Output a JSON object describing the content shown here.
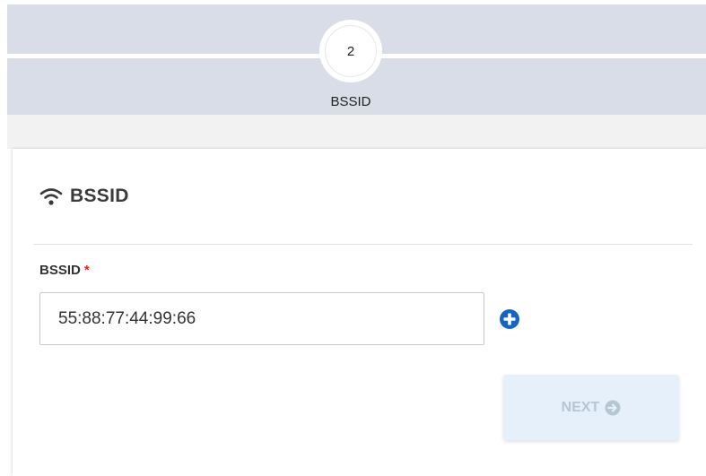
{
  "stepper": {
    "step_number": "2",
    "step_label": "BSSID"
  },
  "card": {
    "title": "BSSID",
    "title_icon": "wifi-icon"
  },
  "form": {
    "bssid_label": "BSSID",
    "required_marker": "*",
    "bssid_value": "55:88:77:44:99:66",
    "add_icon": "plus-circle-icon"
  },
  "actions": {
    "next_label": "NEXT",
    "next_icon": "arrow-circle-right-icon",
    "next_enabled": false
  },
  "colors": {
    "stepper_bg": "#d9dde7",
    "accent": "#1565c0",
    "required": "#d9281f",
    "next_disabled_bg": "#e6f0fa",
    "next_disabled_text": "#b7c6d3"
  }
}
